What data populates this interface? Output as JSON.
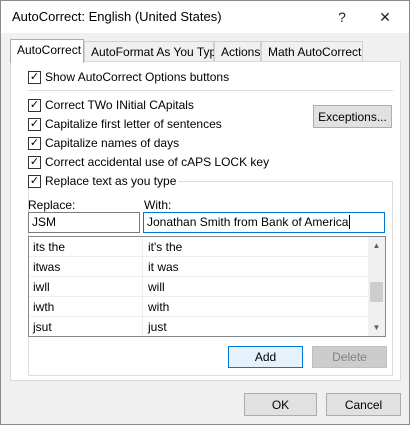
{
  "window": {
    "title": "AutoCorrect: English (United States)",
    "help_glyph": "?",
    "close_glyph": "✕"
  },
  "tabs": [
    {
      "label": "AutoCorrect",
      "active": true
    },
    {
      "label": "AutoFormat As You Type",
      "active": false
    },
    {
      "label": "Actions",
      "active": false
    },
    {
      "label": "Math AutoCorrect",
      "active": false
    }
  ],
  "options": {
    "show_buttons": {
      "label": "Show AutoCorrect Options buttons",
      "checked": true
    },
    "two_initial_caps": {
      "label": "Correct TWo INitial CApitals",
      "checked": true
    },
    "capitalize_sentences": {
      "label": "Capitalize first letter of sentences",
      "checked": true
    },
    "capitalize_days": {
      "label": "Capitalize names of days",
      "checked": true
    },
    "caps_lock": {
      "label": "Correct accidental use of cAPS LOCK key",
      "checked": true
    },
    "replace_text": {
      "label": "Replace text as you type",
      "checked": true
    },
    "check_glyph": "✓"
  },
  "exceptions_label": "Exceptions...",
  "replace": {
    "replace_label": "Replace:",
    "with_label": "With:",
    "replace_value": "JSM",
    "with_value": "Jonathan Smith from Bank of America"
  },
  "entries": [
    {
      "replace": "its the",
      "with": "it's the"
    },
    {
      "replace": "itwas",
      "with": "it was"
    },
    {
      "replace": "iwll",
      "with": "will"
    },
    {
      "replace": "iwth",
      "with": "with"
    },
    {
      "replace": "jsut",
      "with": "just"
    }
  ],
  "scrollbar": {
    "up_glyph": "▲",
    "down_glyph": "▼",
    "position": 0.62
  },
  "buttons": {
    "add": "Add",
    "delete": "Delete",
    "ok": "OK",
    "cancel": "Cancel"
  }
}
